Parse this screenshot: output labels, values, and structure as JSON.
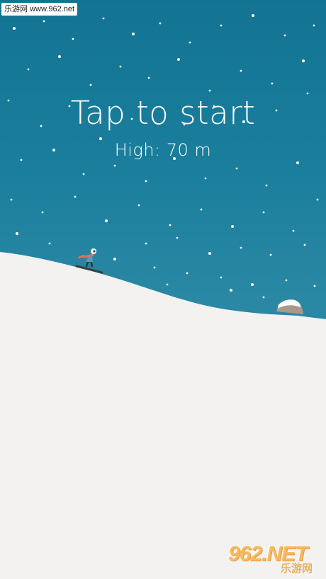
{
  "game": {
    "prompt": "Tap to start",
    "high_score_text": "High: 70 m",
    "high_score_value_m": 70
  },
  "watermarks": {
    "top": "乐游网 www.962.net",
    "bottom_main": "962.NET",
    "bottom_sub": "乐游网"
  },
  "colors": {
    "sky_top": "#137393",
    "sky_bottom": "#2a88a4",
    "snow": "#f3f2f0",
    "text": "#ffffff",
    "skier_scarf": "#e0705a",
    "rock": "#a89a8a"
  },
  "icons": [
    "skier-icon",
    "rock-icon",
    "snowflake-icon"
  ]
}
